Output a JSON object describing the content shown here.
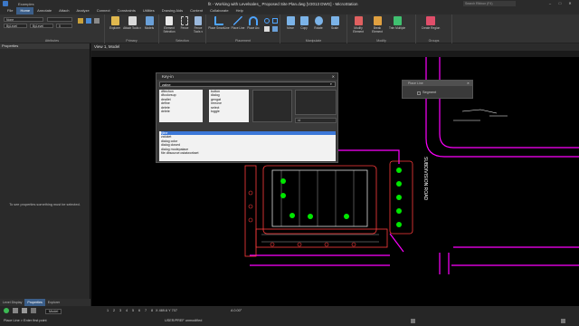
{
  "titlebar": {
    "workspace": "Examples",
    "title": "fit - Working with Levelsales_ Proposed Site Plan.dwg [V2013 DWG] - MicroStation",
    "search_placeholder": "Search Ribbon (F4)",
    "min": "–",
    "max": "□",
    "close": "✕"
  },
  "menu": [
    "File",
    "Home",
    "Annotate",
    "Attach",
    "Analyze",
    "Connect",
    "Constraints",
    "Utilities",
    "Drawing Aids",
    "Content",
    "Collaborate",
    "Help"
  ],
  "ribbon": {
    "attributes": {
      "label": "Attributes",
      "level": "None",
      "color": "ByLevel",
      "style": "ByLevel",
      "weight": "0"
    },
    "primary": {
      "label": "Primary",
      "explorer": "Explorer",
      "attach_tools": "Attach Tools ▾",
      "models": "Models"
    },
    "selection": {
      "label": "Selection",
      "element_selection": "Element Selection",
      "fence": "Fence",
      "fence_tools": "Fence Tools ▾"
    },
    "placement": {
      "label": "Placement",
      "smartline": "Place SmartLine",
      "line": "Place Line",
      "arc": "Place Arc"
    },
    "manipulate": {
      "label": "Manipulate",
      "move": "Move",
      "copy": "Copy",
      "rotate": "Rotate",
      "scale": "Scale"
    },
    "modify": {
      "label": "Modify",
      "modify_element": "Modify Element",
      "break_element": "Break Element",
      "trim_multiple": "Trim Multiple"
    },
    "groups": {
      "label": "Groups",
      "create_region": "Create Region"
    }
  },
  "left_panel": {
    "title": "Properties",
    "message": "To see properties something must be selected.",
    "tabs": [
      "Level Display",
      "Properties",
      "Explorer"
    ]
  },
  "view": {
    "title": "View 1, Model",
    "road_label": "SUBDIVISION ROAD"
  },
  "keyin": {
    "title": "Key-in",
    "value": "zalne",
    "list_left": [
      "dftechon",
      "dfcolorsup",
      "deallet",
      "define",
      "delete",
      "delete"
    ],
    "list_mid": [
      "button",
      "dialog",
      "gengat",
      "remove",
      "select",
      "toggle"
    ],
    "field_label": "rd",
    "history": [
      "fjline",
      "zaluket",
      "dialog color",
      "dialog closed",
      "dialog modepalace",
      "file dbsource:ostatworkset"
    ]
  },
  "float_dialog": {
    "title": "Place Line",
    "checkbox": "Segment"
  },
  "status": {
    "prompt": "Place Line > Enter first point",
    "model": "Model",
    "coords": "X 469.6 Y 707",
    "angle": "A 0.00°",
    "message": "USER/PREF unmodified",
    "pages": [
      "1",
      "2",
      "3",
      "4",
      "5",
      "6",
      "7",
      "8"
    ]
  },
  "colors": {
    "accent": "#3c5f8a",
    "road": "#ff00ff",
    "parking": "#ff3b3b",
    "tree": "#00e600",
    "bg": "#000000"
  }
}
